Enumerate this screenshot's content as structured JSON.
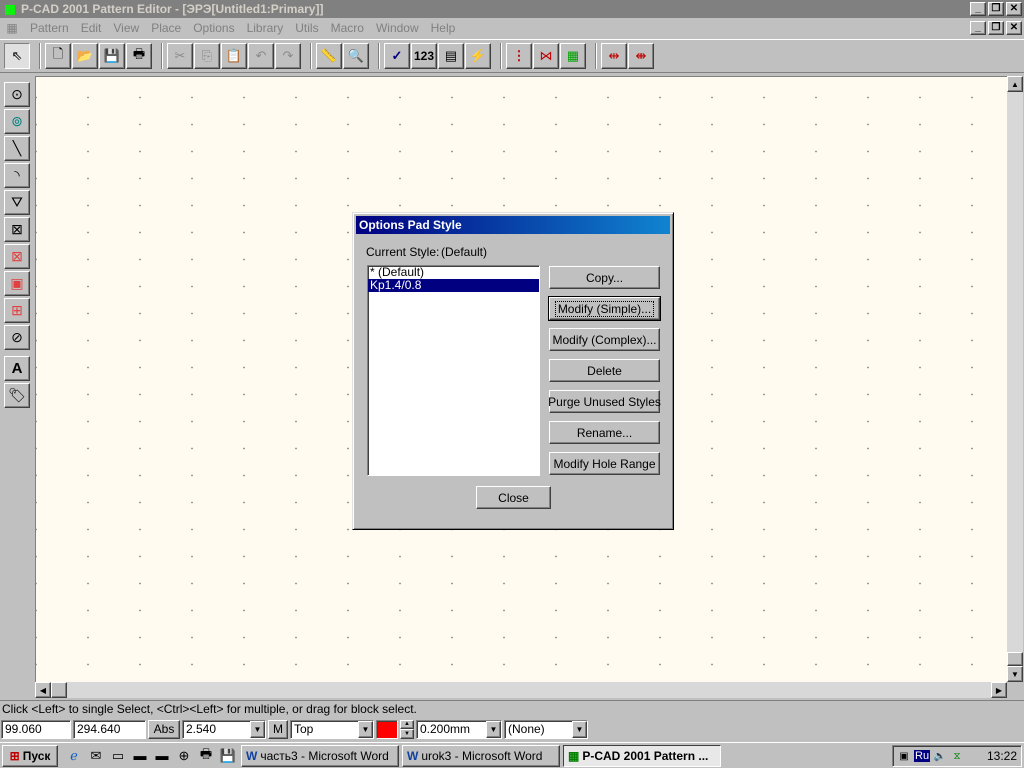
{
  "window": {
    "title": "P-CAD 2001 Pattern Editor - [ЭРЭ[Untitled1:Primary]]",
    "controls": {
      "minimize": "_",
      "restore": "❐",
      "close": "✕"
    }
  },
  "menu": {
    "items": [
      "Pattern",
      "Edit",
      "View",
      "Place",
      "Options",
      "Library",
      "Utils",
      "Macro",
      "Window",
      "Help"
    ]
  },
  "toolbar": {
    "buttons": [
      {
        "name": "select-icon",
        "glyph": "⇖"
      },
      {
        "name": "new-icon",
        "glyph": "🗋"
      },
      {
        "name": "open-icon",
        "glyph": "📂"
      },
      {
        "name": "save-icon",
        "glyph": "💾"
      },
      {
        "name": "print-icon",
        "glyph": "🖶"
      },
      {
        "name": "cut-icon",
        "glyph": "✂"
      },
      {
        "name": "copy-icon",
        "glyph": "⎘"
      },
      {
        "name": "paste-icon",
        "glyph": "📋"
      },
      {
        "name": "undo-icon",
        "glyph": "↶"
      },
      {
        "name": "redo-icon",
        "glyph": "↷"
      },
      {
        "name": "measure-icon",
        "glyph": "📏"
      },
      {
        "name": "zoom-icon",
        "glyph": "🔍"
      },
      {
        "name": "check-icon",
        "glyph": "✓"
      },
      {
        "name": "renumber-label",
        "glyph": "123"
      },
      {
        "name": "pattern-properties-icon",
        "glyph": "▤"
      },
      {
        "name": "lightning-icon",
        "glyph": "⚡"
      },
      {
        "name": "pad-align-icon",
        "glyph": "⋮"
      },
      {
        "name": "pad-mirror-icon",
        "glyph": "⋈"
      },
      {
        "name": "pad-color-icon",
        "glyph": "▦"
      },
      {
        "name": "pad-spread-icon",
        "glyph": "⇹"
      },
      {
        "name": "pad-gather-icon",
        "glyph": "⇼"
      }
    ]
  },
  "palette": {
    "tools": [
      {
        "name": "place-pad-icon",
        "glyph": "⊙"
      },
      {
        "name": "place-via-icon",
        "glyph": "⊚"
      },
      {
        "name": "place-line-icon",
        "glyph": "╲"
      },
      {
        "name": "place-arc-icon",
        "glyph": "◝"
      },
      {
        "name": "place-polygon-icon",
        "glyph": "⛛"
      },
      {
        "name": "place-keepout-icon",
        "glyph": "⊠"
      },
      {
        "name": "place-copper-icon",
        "glyph": "⊠"
      },
      {
        "name": "place-cutout-icon",
        "glyph": "▣"
      },
      {
        "name": "place-plane-icon",
        "glyph": "⊞"
      },
      {
        "name": "place-prohibited-icon",
        "glyph": "⊘"
      },
      {
        "name": "place-text-icon",
        "glyph": "A"
      },
      {
        "name": "place-attribute-icon",
        "glyph": "🏷"
      }
    ]
  },
  "colors": {
    "workspace": "#fffbf0",
    "title_active": "#000080",
    "layer_color": "#ff0000"
  },
  "dialog": {
    "title": "Options Pad Style",
    "current_style_label": "Current Style:",
    "current_style_value": "(Default)",
    "styles": [
      "* (Default)",
      "Kp1.4/0.8"
    ],
    "buttons": {
      "copy": "Copy...",
      "modify_simple": "Modify (Simple)...",
      "modify_complex": "Modify (Complex)...",
      "delete": "Delete",
      "purge": "Purge Unused Styles",
      "rename": "Rename...",
      "hole_range": "Modify Hole Range",
      "close": "Close"
    }
  },
  "status": {
    "message": "Click <Left> to single Select, <Ctrl><Left> for multiple, or drag for block select.",
    "x": "99.060",
    "y": "294.640",
    "abs_label": "Abs",
    "grid": "2.540",
    "m_label": "M",
    "layer": "Top",
    "line_width": "0.200mm",
    "pad_option": "(None)"
  },
  "taskbar": {
    "start": "Пуск",
    "tasks": [
      {
        "label": "часть3 - Microsoft Word",
        "active": false
      },
      {
        "label": "urok3 - Microsoft Word",
        "active": false
      },
      {
        "label": "P-CAD 2001 Pattern ...",
        "active": true
      }
    ],
    "lang": "Ru",
    "clock": "13:22"
  }
}
